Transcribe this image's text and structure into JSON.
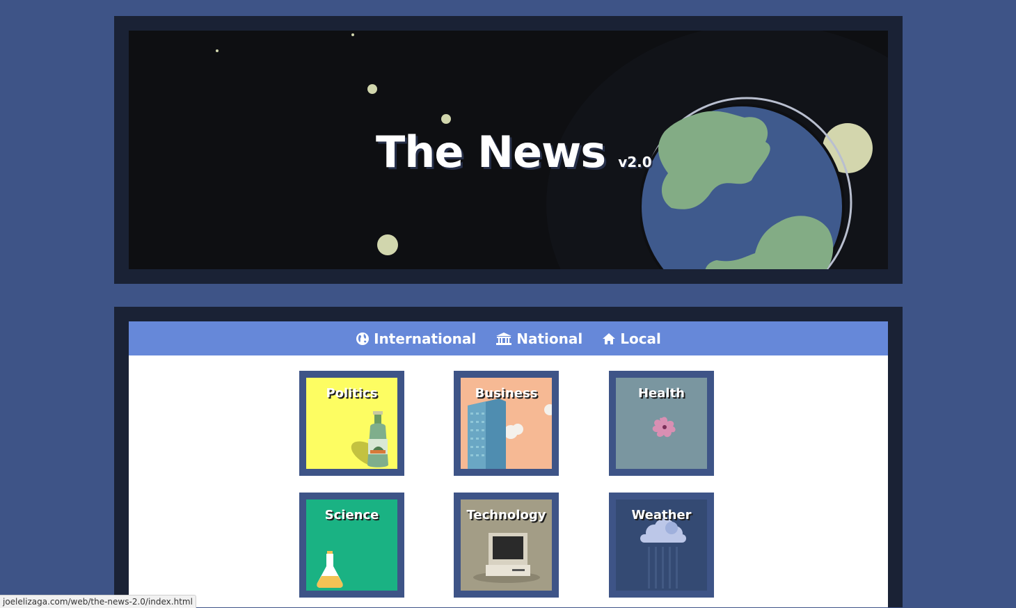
{
  "header": {
    "title": "The News",
    "version": "v2.0"
  },
  "nav": {
    "items": [
      {
        "label": "International",
        "icon": "globe-icon"
      },
      {
        "label": "National",
        "icon": "bank-icon"
      },
      {
        "label": "Local",
        "icon": "home-icon"
      }
    ]
  },
  "categories": [
    {
      "label": "Politics",
      "color": "#fdfd62",
      "icon": "bottle-icon"
    },
    {
      "label": "Business",
      "color": "#f6b994",
      "icon": "skyscraper-icon"
    },
    {
      "label": "Health",
      "color": "#7a96a0",
      "icon": "virus-icon"
    },
    {
      "label": "Science",
      "color": "#1ab283",
      "icon": "flask-icon"
    },
    {
      "label": "Technology",
      "color": "#a39d86",
      "icon": "computer-icon"
    },
    {
      "label": "Weather",
      "color": "#344a73",
      "icon": "cloud-icon"
    }
  ],
  "colors": {
    "background": "#3e5487",
    "frame": "#1a2235",
    "nav": "#6688d9",
    "space": "#0e0f12"
  },
  "status_bar": {
    "url": "joelelizaga.com/web/the-news-2.0/index.html"
  }
}
